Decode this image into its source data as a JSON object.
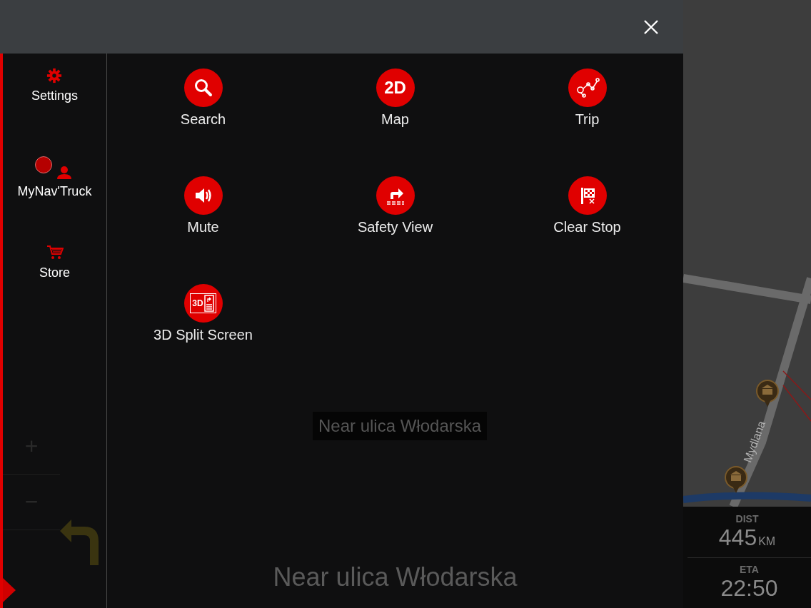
{
  "sidebar": {
    "items": [
      {
        "kind": "settings",
        "label": "Settings"
      },
      {
        "kind": "profile",
        "label": "MyNav'Truck"
      },
      {
        "kind": "store",
        "label": "Store"
      }
    ],
    "zoom": [
      "+",
      "−"
    ]
  },
  "menu": {
    "items": [
      {
        "kind": "search",
        "label": "Search"
      },
      {
        "kind": "map2d",
        "label": "Map",
        "icon_text": "2D"
      },
      {
        "kind": "trip",
        "label": "Trip"
      },
      {
        "kind": "sound",
        "label": "Mute"
      },
      {
        "kind": "safety",
        "label": "Safety View"
      },
      {
        "kind": "flag",
        "label": "Clear Stop"
      },
      {
        "kind": "split",
        "label": "3D Split Screen",
        "icon_text": "3D"
      }
    ]
  },
  "map": {
    "location_label": "Near ulica Włodarska",
    "street_label": "Mydlana",
    "current_street": "Near ulica Włodarska"
  },
  "trip_info": {
    "distance_label": "DIST",
    "distance": "445",
    "distance_unit": "KM",
    "eta_label": "ETA",
    "eta": "22:50"
  }
}
